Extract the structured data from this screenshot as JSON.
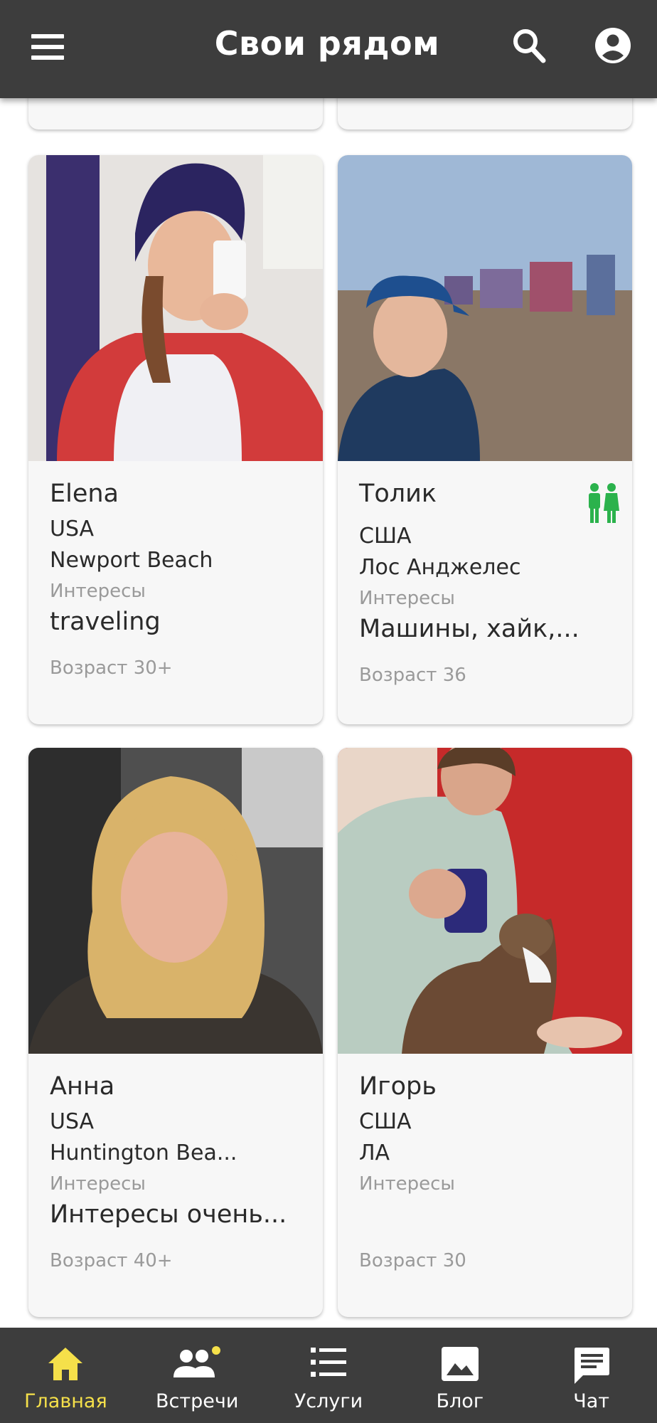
{
  "header": {
    "title": "Свои рядом"
  },
  "colors": {
    "header_bg": "#3d3d3d",
    "accent_active": "#f5e04a",
    "badge": "#f5e04a",
    "couple_icon": "#2bb24c"
  },
  "cards": [
    {
      "name": "Elena",
      "country": "USA",
      "city": "Newport Beach",
      "interests_label": "Интересы",
      "interests": "traveling",
      "age": "Возраст 30+"
    },
    {
      "name": "Толик",
      "country": "США",
      "city": "Лос Анджелес",
      "interests_label": "Интересы",
      "interests": "Машины, хайк,...",
      "age": "Возраст 36",
      "icon": "couple-icon"
    },
    {
      "name": "Анна",
      "country": "USA",
      "city": "Huntington Bea...",
      "interests_label": "Интересы",
      "interests": "Интересы очень...",
      "age": "Возраст 40+"
    },
    {
      "name": "Игорь",
      "country": "США",
      "city": "ЛА",
      "interests_label": "Интересы",
      "interests": "",
      "age": "Возраст 30"
    }
  ],
  "bottom_nav": [
    {
      "label": "Главная",
      "icon": "home-icon",
      "active": true
    },
    {
      "label": "Встречи",
      "icon": "people-icon",
      "badge": true
    },
    {
      "label": "Услуги",
      "icon": "list-icon"
    },
    {
      "label": "Блог",
      "icon": "image-icon"
    },
    {
      "label": "Чат",
      "icon": "chat-icon"
    }
  ]
}
